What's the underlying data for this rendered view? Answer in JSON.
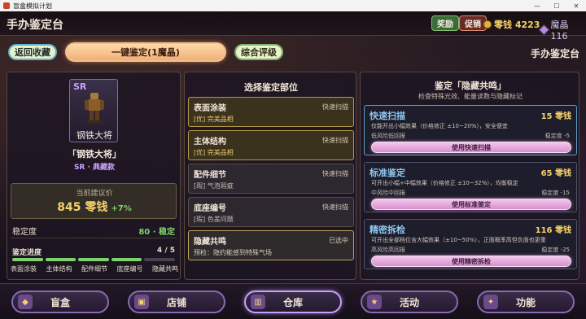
{
  "window": {
    "title": "盲盒模拟计划"
  },
  "header": {
    "page_title": "手办鉴定台",
    "reward_label": "奖励",
    "promo_label": "促销",
    "coins_text": "零钱 4223",
    "gems_text": "魔晶 116"
  },
  "nav": {
    "back_label": "返回收藏",
    "appraise_label": "一键鉴定(1魔晶)",
    "rating_label": "综合评级",
    "section_title": "手办鉴定台"
  },
  "figure": {
    "rarity": "SR",
    "card_name": "钢铁大将",
    "name": "「钢铁大将」",
    "grade": "SR · 典藏款",
    "price_label": "当前建议价",
    "price_value": "845 零钱",
    "price_change": "+7%",
    "stability_label": "稳定度",
    "stability_value": "80 · 稳定",
    "progress_label": "鉴定进度",
    "progress_count": "4 / 5",
    "progress_done": 4,
    "progress_total": 5,
    "progress_parts": [
      "表面涂装",
      "主体结构",
      "配件细节",
      "底座编号",
      "隐藏共鸣"
    ]
  },
  "parts": {
    "title": "选择鉴定部位",
    "items": [
      {
        "name": "表面涂装",
        "status": "快速扫描",
        "result": "[优] 完美品相"
      },
      {
        "name": "主体结构",
        "status": "快速扫描",
        "result": "[优] 完美品相"
      },
      {
        "name": "配件细节",
        "status": "快速扫描",
        "result": "[瑕] 气泡瑕疵"
      },
      {
        "name": "底座编号",
        "status": "快速扫描",
        "result": "[瑕] 色差问题"
      },
      {
        "name": "隐藏共鸣",
        "status": "已选中",
        "result": "预检：隐约能感到特殊气场"
      }
    ]
  },
  "appraisal": {
    "title": "鉴定「隐藏共鸣」",
    "subtitle": "检查特殊光效、能量读数与隐藏标记",
    "methods": [
      {
        "name": "快速扫描",
        "price": "15 零钱",
        "desc": "仅能开出小幅效果（价格修正 ±10~20%），安全便宜",
        "risk": "低风险低回报",
        "stability": "稳定度 -5",
        "button": "使用快速扫描"
      },
      {
        "name": "标准鉴定",
        "price": "65 零钱",
        "desc": "可开出小幅+中幅效果（价格修正 ±10~32%），均衡稳定",
        "risk": "中风险中回报",
        "stability": "稳定度 -15",
        "button": "使用标准鉴定"
      },
      {
        "name": "精密拆检",
        "price": "116 零钱",
        "desc": "可开出全部档位含大幅效果（±10~50%），正面概率高但负面也更重",
        "risk": "高风险高回报",
        "stability": "稳定度 -25",
        "button": "使用精密拆检"
      }
    ]
  },
  "tabs": [
    {
      "label": "盲盒",
      "icon": "blind-box-icon"
    },
    {
      "label": "店铺",
      "icon": "shop-icon"
    },
    {
      "label": "仓库",
      "icon": "warehouse-icon"
    },
    {
      "label": "活动",
      "icon": "event-icon"
    },
    {
      "label": "功能",
      "icon": "feature-icon"
    }
  ],
  "colors": {
    "accent_gold": "#f6d26a",
    "accent_green": "#7fd06e",
    "accent_purple": "#c9a0ff",
    "method_blue": "#8ec8f0"
  }
}
